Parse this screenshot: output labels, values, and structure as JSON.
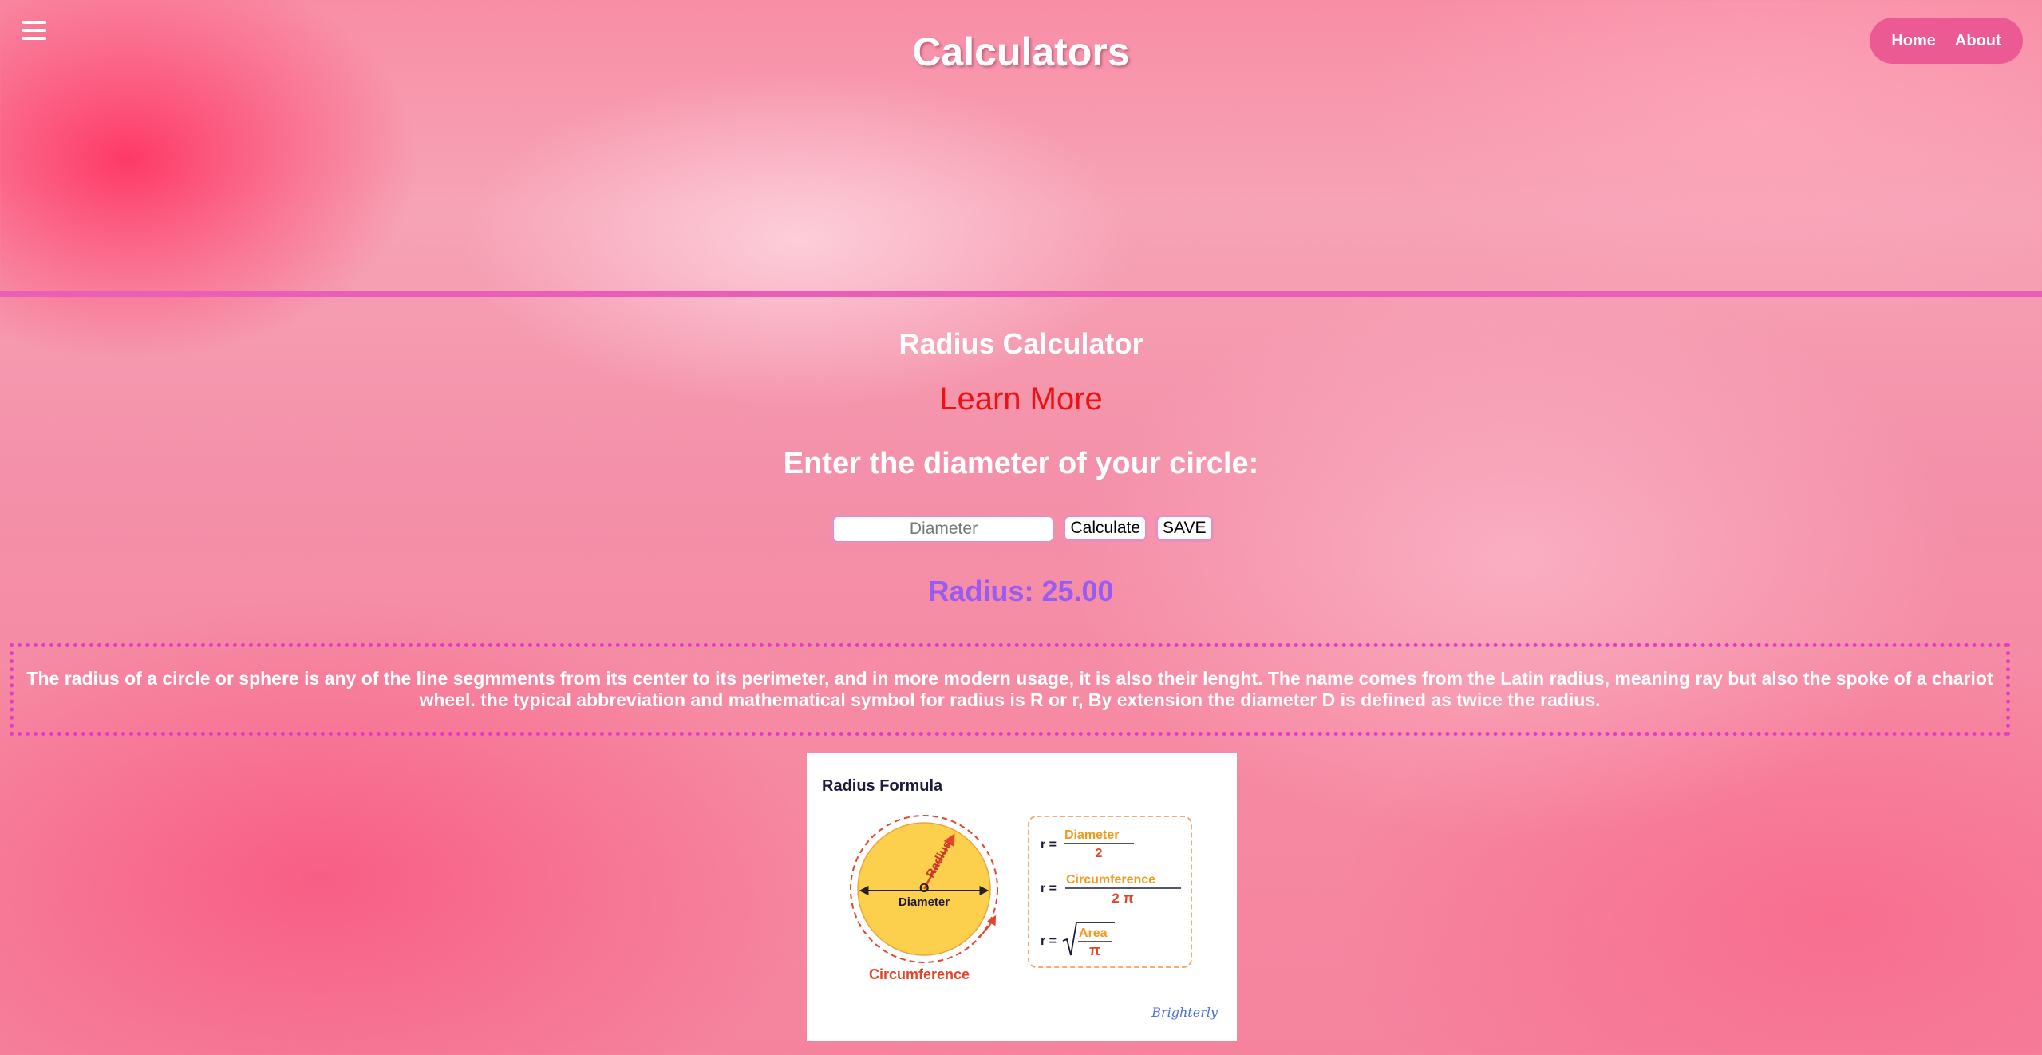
{
  "header": {
    "menu_icon": "hamburger-menu-icon",
    "title": "Calculators",
    "nav": [
      {
        "label": "Home"
      },
      {
        "label": "About"
      }
    ]
  },
  "calculator": {
    "title": "Radius Calculator",
    "learn_more": "Learn More",
    "prompt": "Enter the diameter of your circle:",
    "diameter_input": {
      "value": "",
      "placeholder": "Diameter"
    },
    "calculate_label": "Calculate",
    "save_label": "SAVE",
    "result": "Radius: 25.00"
  },
  "description": "The radius of a circle or sphere is any of the line segmments from its center to its perimeter, and in more modern usage, it is also their lenght. The name comes from the Latin radius, meaning ray but also the spoke of a chariot wheel. the typical abbreviation and mathematical symbol for radius is R or r, By extension the diameter D is defined as twice the radius.",
  "formula_image": {
    "title": "Radius Formula",
    "center_label": "O",
    "radius_label": "Radius",
    "diameter_label": "Diameter",
    "circumference_label": "Circumference",
    "formulas": {
      "r_eq": "r =",
      "f1_numerator": "Diameter",
      "f1_denominator": "2",
      "f2_numerator": "Circumference",
      "f2_denominator": "2 π",
      "f3_numerator": "Area",
      "f3_denominator": "π"
    },
    "brand": "Brighterly"
  },
  "colors": {
    "title_white": "#ffffff",
    "learn_more_red": "#ee1111",
    "result_purple": "#9a5cf0",
    "nav_pill": "#ec5a93",
    "divider": "#e95fb8",
    "dotted_border": "#e23cc6",
    "circle_fill": "#fcd04d",
    "formula_orange": "#f29a1a",
    "formula_red": "#e2452a"
  }
}
